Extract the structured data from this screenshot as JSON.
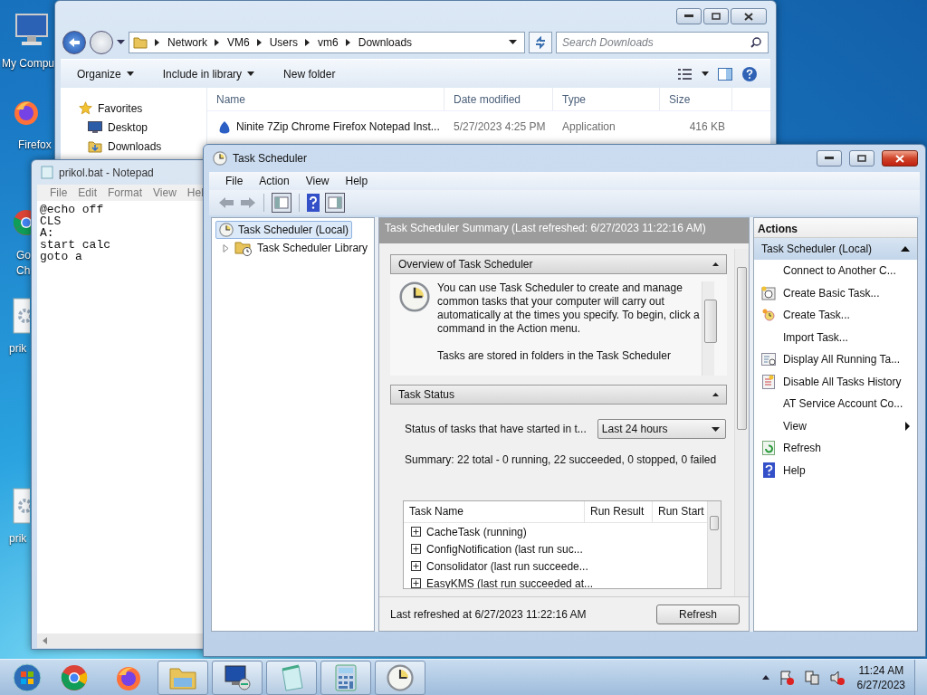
{
  "desktop_icons": [
    {
      "kind": "computer",
      "label_lines": [
        "My Compu"
      ]
    },
    {
      "kind": "firefox",
      "label_lines": [
        "Firefox"
      ]
    },
    {
      "kind": "chrome",
      "label_lines": [
        "Go",
        "Ch"
      ]
    },
    {
      "kind": "file",
      "label_lines": [
        "prik"
      ]
    },
    {
      "kind": "file",
      "label_lines": [
        "prik"
      ]
    }
  ],
  "explorer": {
    "address": [
      "Network",
      "VM6",
      "Users",
      "vm6",
      "Downloads"
    ],
    "search": {
      "placeholder": "Search Downloads"
    },
    "toolbar": [
      {
        "label": "Organize",
        "has_menu": true
      },
      {
        "label": "Include in library",
        "has_menu": true
      },
      {
        "label": "New folder",
        "has_menu": false
      }
    ],
    "favorites": {
      "title": "Favorites",
      "items": [
        {
          "kind": "desktop",
          "label": "Desktop"
        },
        {
          "kind": "downloads",
          "label": "Downloads"
        }
      ]
    },
    "columns": [
      "Name",
      "Date modified",
      "Type",
      "Size"
    ],
    "rows": [
      {
        "name": "Ninite 7Zip Chrome Firefox Notepad Inst...",
        "date": "5/27/2023 4:25 PM",
        "type": "Application",
        "size": "416 KB"
      }
    ]
  },
  "notepad": {
    "title": "prikol.bat - Notepad",
    "menu": [
      "File",
      "Edit",
      "Format",
      "View",
      "Hel"
    ],
    "lines": [
      "@echo off",
      "CLS",
      "A:",
      "start calc",
      "goto a"
    ]
  },
  "scheduler": {
    "title": "Task Scheduler",
    "menu": [
      "File",
      "Action",
      "View",
      "Help"
    ],
    "tree": [
      {
        "label": "Task Scheduler (Local)",
        "selected": true,
        "children": [
          {
            "label": "Task Scheduler Library",
            "selected": false,
            "expanded": false
          }
        ]
      }
    ],
    "summary_title": "Task Scheduler Summary (Last refreshed: 6/27/2023 11:22:16 AM)",
    "overview": {
      "title": "Overview of Task Scheduler",
      "paragraphs": [
        "You can use Task Scheduler to create and manage common tasks that your computer will carry out automatically at the times you specify. To begin, click a command in the Action menu.",
        "Tasks are stored in folders in the Task Scheduler"
      ]
    },
    "status": {
      "title": "Task Status",
      "period_label": "Status of tasks that have started in t...",
      "period": "Last 24 hours",
      "summary": "Summary: 22 total - 0 running, 22 succeeded, 0 stopped, 0 failed",
      "columns": [
        "Task Name",
        "Run Result",
        "Run Start"
      ],
      "tasks": [
        "CacheTask (running)",
        "ConfigNotification (last run suc...",
        "Consolidator (last run succeede...",
        "EasyKMS (last run succeeded at..."
      ]
    },
    "last_refreshed": "Last refreshed at 6/27/2023 11:22:16 AM",
    "refresh_button": "Refresh",
    "actions": {
      "title": "Actions",
      "group": "Task Scheduler (Local)",
      "items": [
        {
          "kind": "plain",
          "label": "Connect to Another C..."
        },
        {
          "kind": "basic-task",
          "label": "Create Basic Task..."
        },
        {
          "kind": "create-task",
          "label": "Create Task..."
        },
        {
          "kind": "plain",
          "label": "Import Task..."
        },
        {
          "kind": "running",
          "label": "Display All Running Ta..."
        },
        {
          "kind": "history",
          "label": "Disable All Tasks History"
        },
        {
          "kind": "plain",
          "label": "AT Service Account Co..."
        },
        {
          "kind": "submenu",
          "label": "View"
        },
        {
          "kind": "refresh",
          "label": "Refresh"
        },
        {
          "kind": "help",
          "label": "Help"
        }
      ]
    }
  },
  "taskbar": {
    "items": [
      {
        "kind": "chrome",
        "running": false
      },
      {
        "kind": "firefox",
        "running": false
      },
      {
        "kind": "explorer",
        "running": true
      },
      {
        "kind": "remote",
        "running": true
      },
      {
        "kind": "notepad",
        "running": true
      },
      {
        "kind": "calculator",
        "running": true
      },
      {
        "kind": "scheduler",
        "running": true
      }
    ],
    "time": "11:24 AM",
    "date": "6/27/2023"
  }
}
